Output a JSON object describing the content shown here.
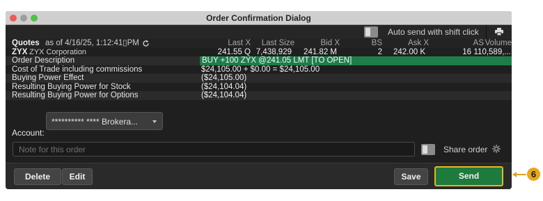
{
  "window": {
    "title": "Order Confirmation Dialog"
  },
  "topbar": {
    "auto_send_label": "Auto send with shift click",
    "auto_send_checked": false,
    "print_icon": "printer-icon"
  },
  "quotes": {
    "label": "Quotes",
    "as_of": "as of 4/16/25, 1:12:41▯PM",
    "refresh_icon": "refresh-icon",
    "columns": [
      "Last X",
      "Last Size",
      "Bid X",
      "BS",
      "Ask X",
      "AS",
      "Volume"
    ],
    "row": {
      "symbol": "ZYX",
      "company": "ZYX Corporation",
      "last": "241.55 Q",
      "last_size": "7,438,929",
      "bid": "241.82 M",
      "bs": "2",
      "ask": "242.00 K",
      "as": "16",
      "volume": "110,589,..."
    }
  },
  "details": [
    {
      "label": "Order Description",
      "value": "BUY +100 ZYX @241.05 LMT [TO OPEN]",
      "highlight": true
    },
    {
      "label": "Cost of Trade including commissions",
      "value": "$24,105.00 + $0.00 = $24,105.00",
      "highlight": false
    },
    {
      "label": "Buying Power Effect",
      "value": "($24,105.00)",
      "highlight": false
    },
    {
      "label": "Resulting Buying Power for Stock",
      "value": "($24,104.04)",
      "highlight": false
    },
    {
      "label": "Resulting Buying Power for Options",
      "value": "($24,104.04)",
      "highlight": false
    }
  ],
  "account": {
    "label": "Account:",
    "value": "********** **** Brokera..."
  },
  "note": {
    "placeholder": "Note for this order",
    "value": ""
  },
  "share": {
    "label": "Share order",
    "checked": false,
    "gear_icon": "gear-icon"
  },
  "buttons": {
    "delete": "Delete",
    "edit": "Edit",
    "save": "Save",
    "send": "Send"
  },
  "callout": {
    "number": "6"
  },
  "colors": {
    "window_bg": "#1f1f1f",
    "order_highlight": "#1f7d49",
    "send_button": "#1e7a3d",
    "send_border": "#e6b820",
    "callout": "#e8a81c"
  }
}
